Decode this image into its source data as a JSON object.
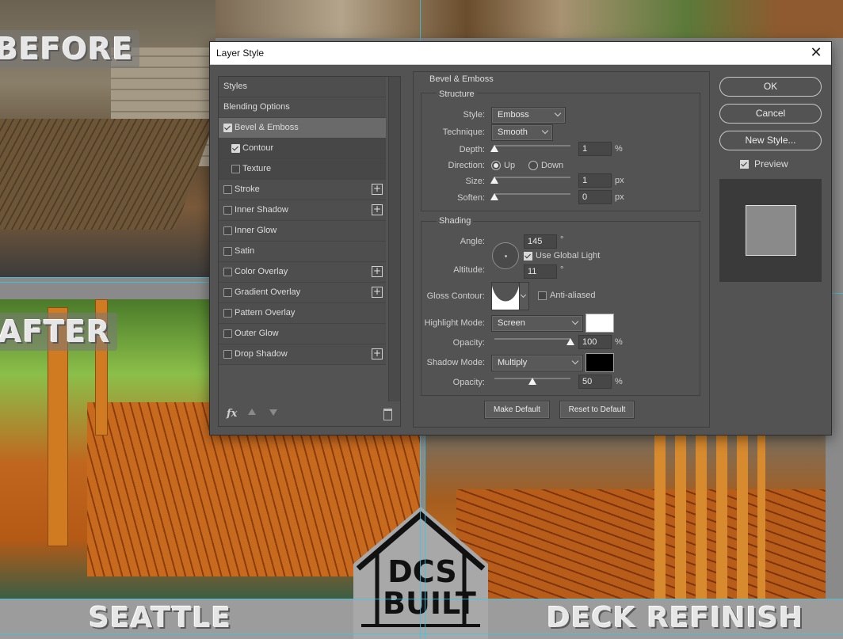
{
  "background": {
    "before_label": "BEFORE",
    "after_label": "AFTER",
    "location_label": "SEATTLE",
    "service_label": "DECK REFINISH",
    "logo_line1": "DCS",
    "logo_line2": "BUILT"
  },
  "dialog": {
    "title": "Layer Style",
    "close_label": "✕",
    "styles_list": [
      {
        "label": "Styles",
        "checkbox": null,
        "plus": false
      },
      {
        "label": "Blending Options",
        "checkbox": null,
        "plus": false
      },
      {
        "label": "Bevel & Emboss",
        "checkbox": true,
        "plus": false,
        "selected": true
      },
      {
        "label": "Contour",
        "checkbox": true,
        "plus": false,
        "sub": true
      },
      {
        "label": "Texture",
        "checkbox": false,
        "plus": false,
        "sub": true
      },
      {
        "label": "Stroke",
        "checkbox": false,
        "plus": true
      },
      {
        "label": "Inner Shadow",
        "checkbox": false,
        "plus": true
      },
      {
        "label": "Inner Glow",
        "checkbox": false,
        "plus": false
      },
      {
        "label": "Satin",
        "checkbox": false,
        "plus": false
      },
      {
        "label": "Color Overlay",
        "checkbox": false,
        "plus": true
      },
      {
        "label": "Gradient Overlay",
        "checkbox": false,
        "plus": true
      },
      {
        "label": "Pattern Overlay",
        "checkbox": false,
        "plus": false
      },
      {
        "label": "Outer Glow",
        "checkbox": false,
        "plus": false
      },
      {
        "label": "Drop Shadow",
        "checkbox": false,
        "plus": true
      }
    ],
    "fx_label": "fx",
    "panel": {
      "title": "Bevel & Emboss",
      "structure": {
        "heading": "Structure",
        "style_label": "Style:",
        "style_value": "Emboss",
        "technique_label": "Technique:",
        "technique_value": "Smooth",
        "depth_label": "Depth:",
        "depth_value": "1",
        "depth_unit": "%",
        "depth_level": 0.01,
        "direction_label": "Direction:",
        "direction_up": "Up",
        "direction_down": "Down",
        "direction_selected": "Up",
        "size_label": "Size:",
        "size_value": "1",
        "size_unit": "px",
        "soften_label": "Soften:",
        "soften_value": "0",
        "soften_unit": "px"
      },
      "shading": {
        "heading": "Shading",
        "angle_label": "Angle:",
        "angle_value": "145",
        "angle_unit": "°",
        "global_light_label": "Use Global Light",
        "global_light_checked": true,
        "altitude_label": "Altitude:",
        "altitude_value": "11",
        "altitude_unit": "°",
        "gloss_label": "Gloss Contour:",
        "anti_aliased_label": "Anti-aliased",
        "anti_aliased_checked": false,
        "highlight_mode_label": "Highlight Mode:",
        "highlight_mode_value": "Screen",
        "highlight_color": "#ffffff",
        "highlight_opacity_label": "Opacity:",
        "highlight_opacity_value": "100",
        "highlight_opacity_unit": "%",
        "shadow_mode_label": "Shadow Mode:",
        "shadow_mode_value": "Multiply",
        "shadow_color": "#000000",
        "shadow_opacity_label": "Opacity:",
        "shadow_opacity_value": "50",
        "shadow_opacity_unit": "%"
      },
      "make_default_label": "Make Default",
      "reset_default_label": "Reset to Default"
    },
    "buttons": {
      "ok_label": "OK",
      "cancel_label": "Cancel",
      "new_style_label": "New Style...",
      "preview_label": "Preview",
      "preview_checked": true
    }
  }
}
